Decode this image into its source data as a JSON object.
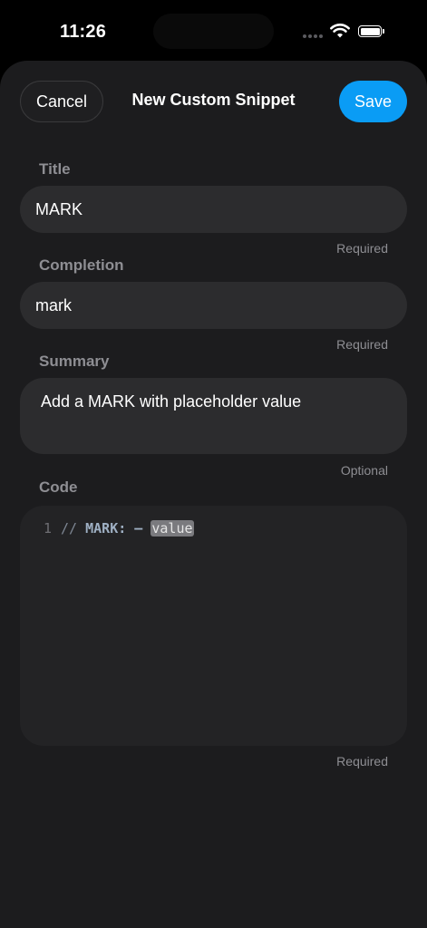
{
  "status_bar": {
    "time": "11:26"
  },
  "header": {
    "cancel_label": "Cancel",
    "title": "New Custom Snippet",
    "save_label": "Save"
  },
  "form": {
    "title": {
      "label": "Title",
      "value": "MARK",
      "hint": "Required"
    },
    "completion": {
      "label": "Completion",
      "value": "mark",
      "hint": "Required"
    },
    "summary": {
      "label": "Summary",
      "value": "Add a MARK with placeholder value",
      "hint": "Optional"
    },
    "code": {
      "label": "Code",
      "hint": "Required",
      "line_number": "1",
      "comment": "//",
      "mark_text": "MARK: –",
      "placeholder": "value"
    }
  },
  "colors": {
    "accent": "#0a9cf5",
    "sheet_background": "#1c1c1e",
    "field_background": "#2c2c2e",
    "secondary_text": "#8e8e93"
  },
  "icons": [
    "cellular-signal-icon",
    "wifi-icon",
    "battery-icon"
  ]
}
